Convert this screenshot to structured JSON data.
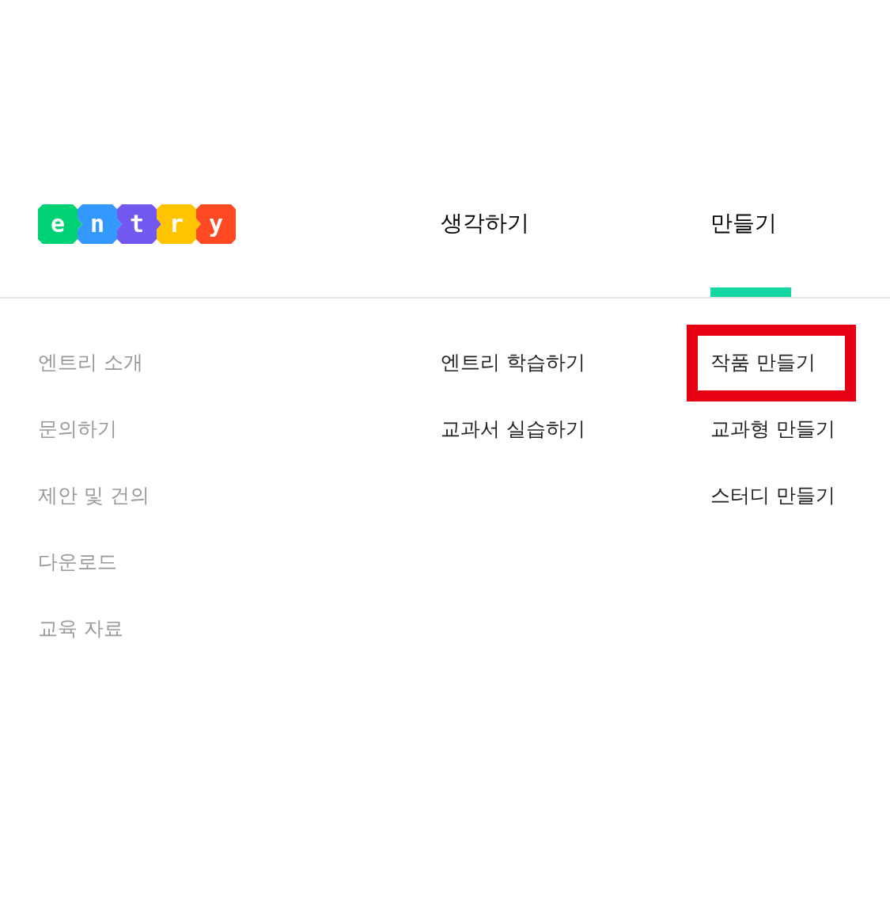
{
  "logo": {
    "letters": [
      {
        "char": "e",
        "color": "#00d274"
      },
      {
        "char": "n",
        "color": "#3399ff"
      },
      {
        "char": "t",
        "color": "#7358ef"
      },
      {
        "char": "r",
        "color": "#ffc400"
      },
      {
        "char": "y",
        "color": "#ff4923"
      }
    ]
  },
  "nav": {
    "tabs": [
      {
        "label": "생각하기",
        "selected": false
      },
      {
        "label": "만들기",
        "selected": true
      }
    ]
  },
  "menu": {
    "columns": [
      {
        "kind": "secondary",
        "items": [
          {
            "label": "엔트리 소개",
            "highlighted": false
          },
          {
            "label": "문의하기",
            "highlighted": false
          },
          {
            "label": "제안 및 건의",
            "highlighted": false
          },
          {
            "label": "다운로드",
            "highlighted": false
          },
          {
            "label": "교육 자료",
            "highlighted": false
          }
        ]
      },
      {
        "kind": "primary",
        "items": [
          {
            "label": "엔트리 학습하기",
            "highlighted": false
          },
          {
            "label": "교과서 실습하기",
            "highlighted": false
          }
        ]
      },
      {
        "kind": "primary",
        "items": [
          {
            "label": "작품 만들기",
            "highlighted": true
          },
          {
            "label": "교과형 만들기",
            "highlighted": false
          },
          {
            "label": "스터디 만들기",
            "highlighted": false
          }
        ]
      }
    ]
  }
}
